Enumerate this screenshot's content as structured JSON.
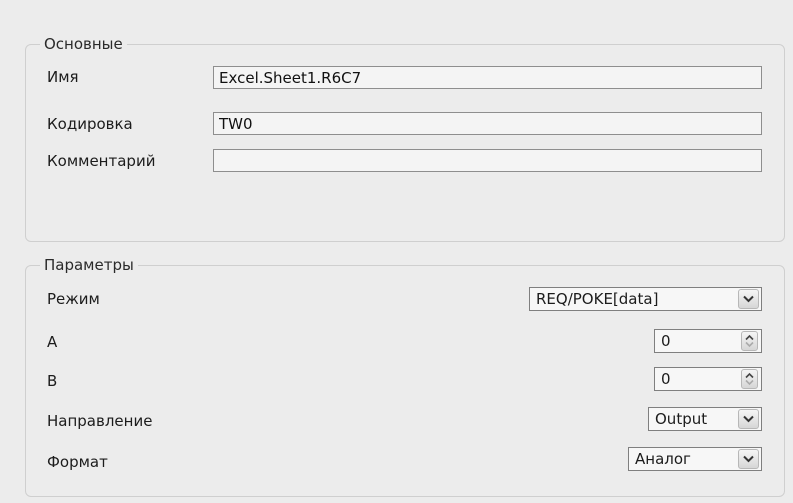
{
  "basic": {
    "legend": "Основные",
    "name_label": "Имя",
    "name_value": "Excel.Sheet1.R6C7",
    "encoding_label": "Кодировка",
    "encoding_value": "TW0",
    "comment_label": "Комментарий",
    "comment_value": ""
  },
  "params": {
    "legend": "Параметры",
    "mode_label": "Режим",
    "mode_value": "REQ/POKE[data]",
    "a_label": "A",
    "a_value": "0",
    "b_label": "B",
    "b_value": "0",
    "direction_label": "Направление",
    "direction_value": "Output",
    "format_label": "Формат",
    "format_value": "Аналог"
  },
  "icons": {
    "dropdown": "chevron-down-icon",
    "spinner": "spin-up-down-icon"
  }
}
